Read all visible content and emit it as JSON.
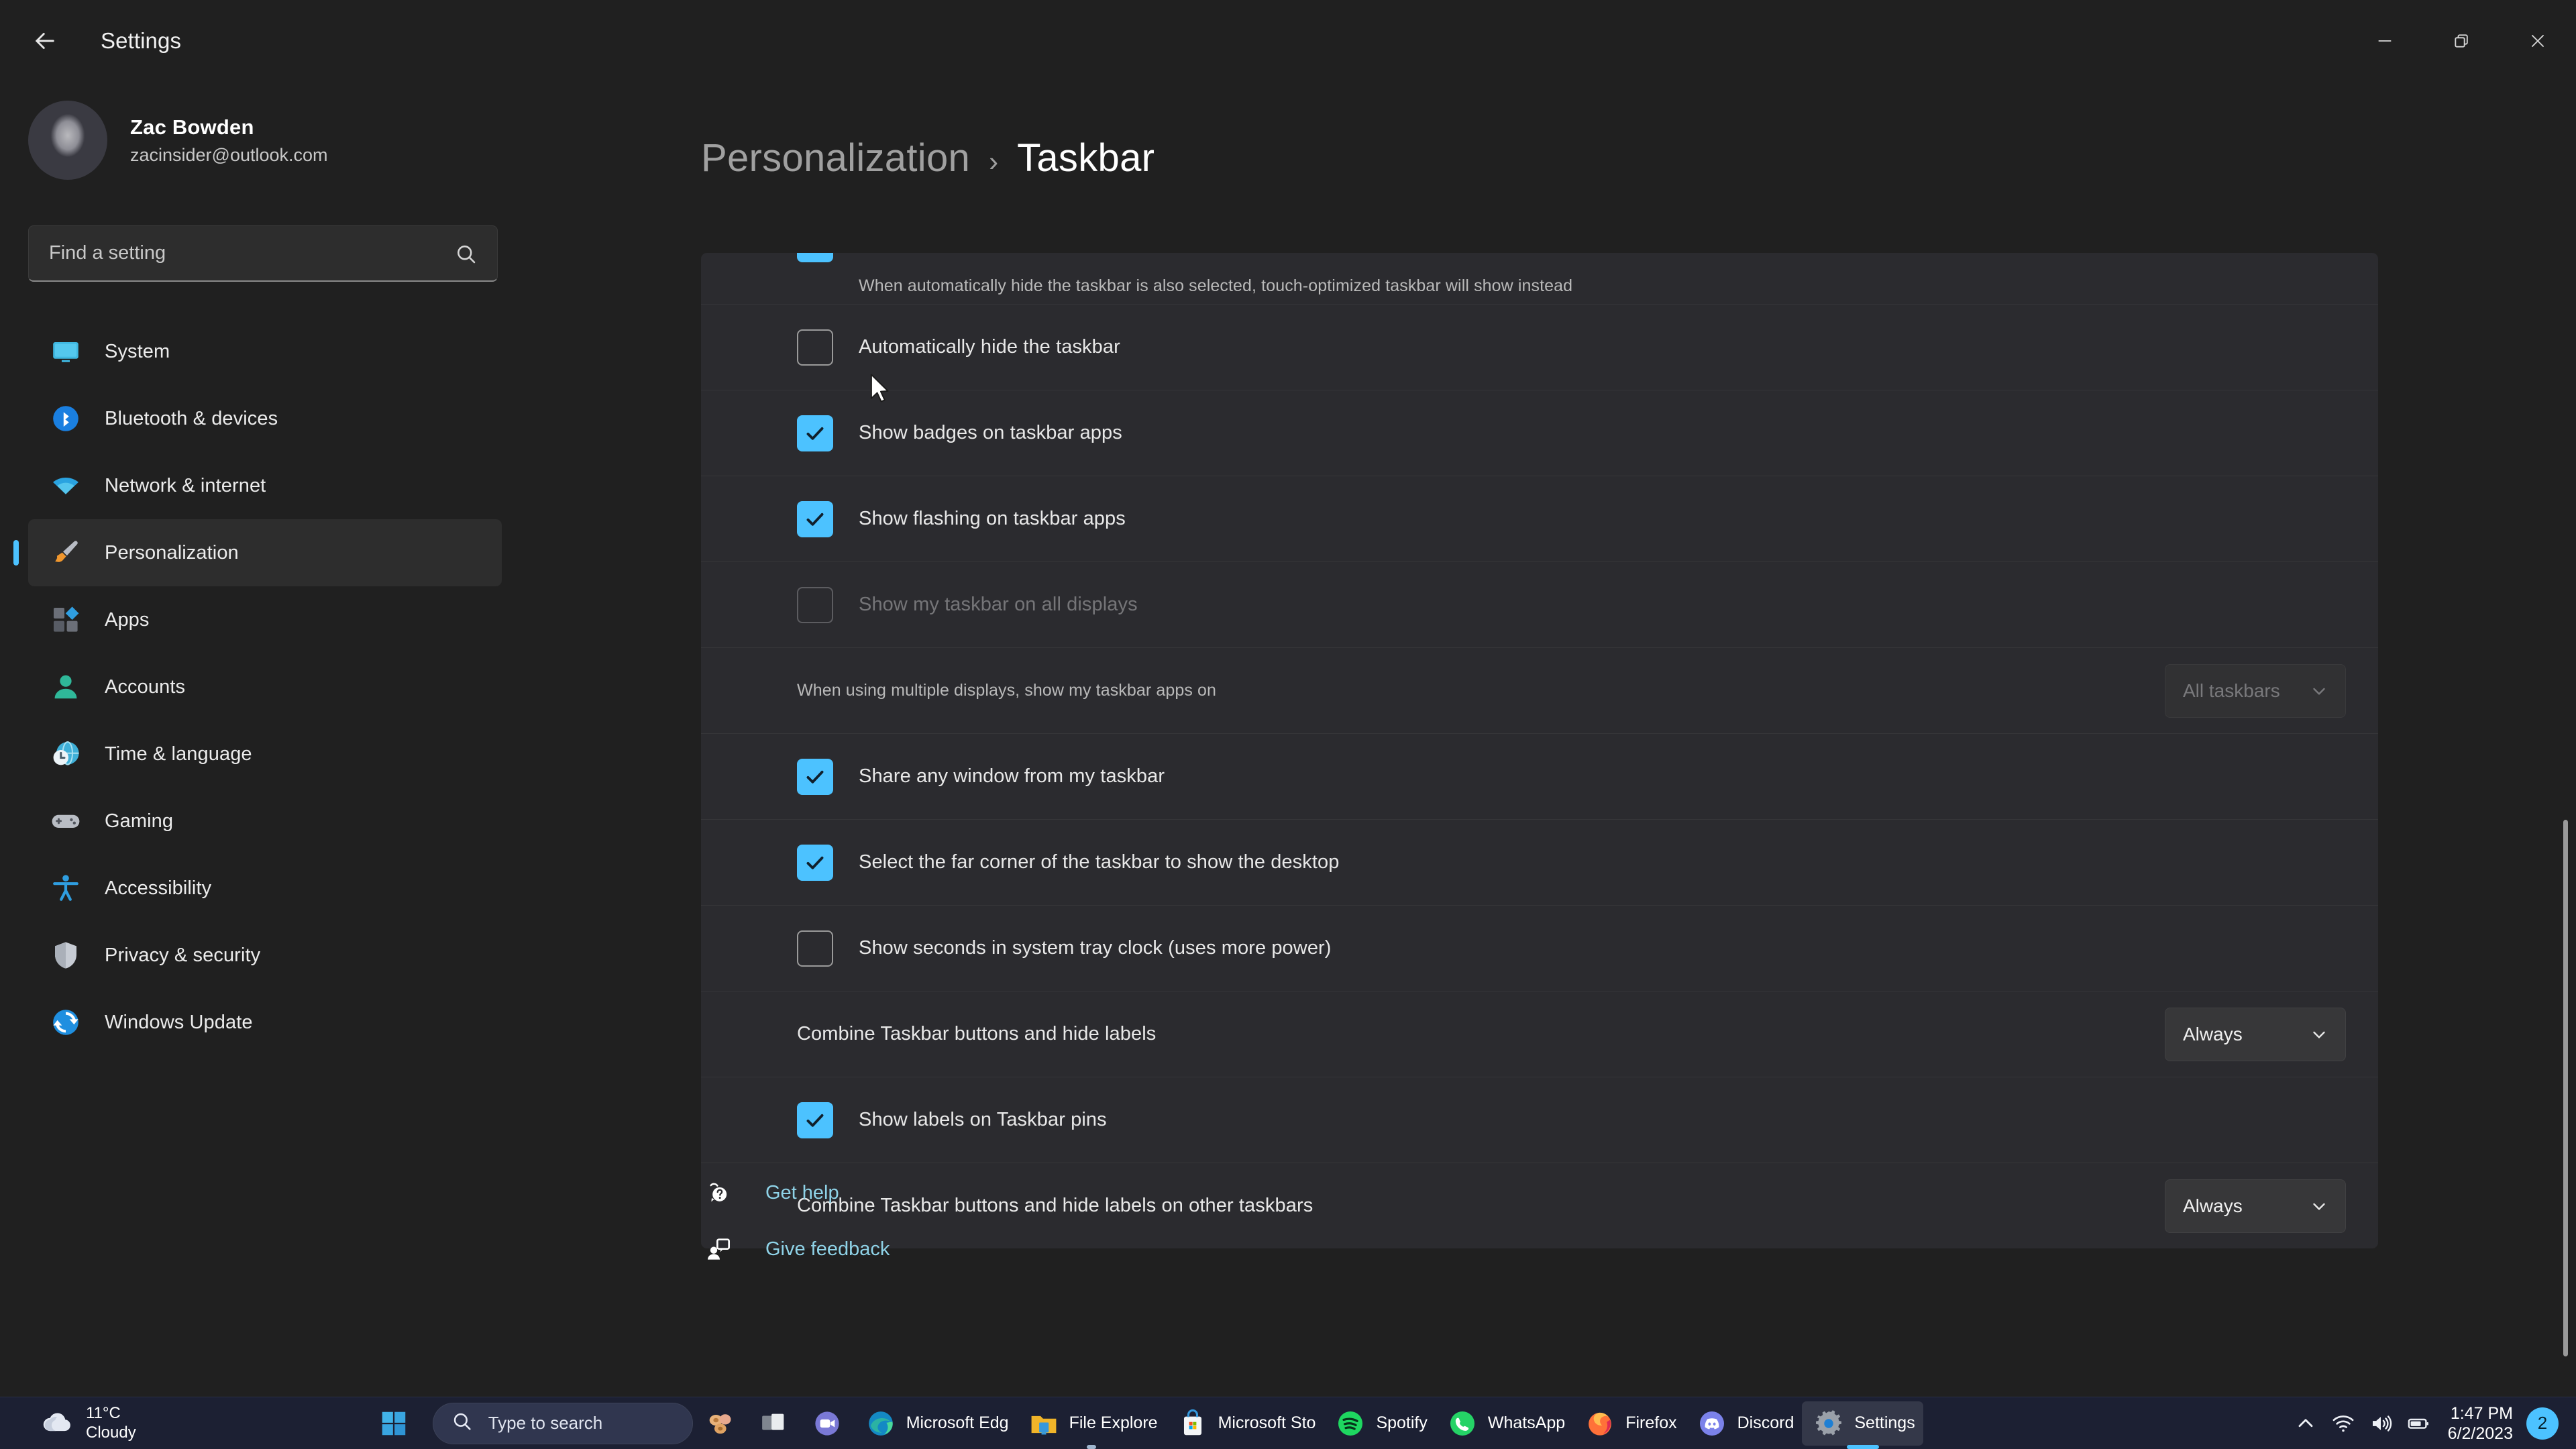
{
  "window": {
    "title": "Settings",
    "back_icon": "arrow-left-icon",
    "controls": {
      "minimize": "minimize-icon",
      "restore": "restore-icon",
      "close": "close-icon"
    }
  },
  "sidebar": {
    "profile": {
      "name": "Zac Bowden",
      "email": "zacinsider@outlook.com"
    },
    "search": {
      "placeholder": "Find a setting",
      "value": "",
      "icon": "search-icon"
    },
    "items": [
      {
        "label": "System",
        "icon": "monitor-icon",
        "selected": false
      },
      {
        "label": "Bluetooth & devices",
        "icon": "bluetooth-icon",
        "selected": false
      },
      {
        "label": "Network & internet",
        "icon": "wifi-icon",
        "selected": false
      },
      {
        "label": "Personalization",
        "icon": "paintbrush-icon",
        "selected": true
      },
      {
        "label": "Apps",
        "icon": "apps-grid-icon",
        "selected": false
      },
      {
        "label": "Accounts",
        "icon": "person-icon",
        "selected": false
      },
      {
        "label": "Time & language",
        "icon": "clock-globe-icon",
        "selected": false
      },
      {
        "label": "Gaming",
        "icon": "gamepad-icon",
        "selected": false
      },
      {
        "label": "Accessibility",
        "icon": "accessibility-icon",
        "selected": false
      },
      {
        "label": "Privacy & security",
        "icon": "shield-icon",
        "selected": false
      },
      {
        "label": "Windows Update",
        "icon": "update-icon",
        "selected": false
      }
    ]
  },
  "breadcrumb": {
    "parent": "Personalization",
    "separator": "›",
    "current": "Taskbar"
  },
  "settings_rows": [
    {
      "type": "clipped-description",
      "description": "When automatically hide the taskbar is also selected, touch-optimized taskbar will show instead",
      "checkbox": {
        "checked": true,
        "clipped": true
      },
      "disabled": false
    },
    {
      "type": "checkbox",
      "label": "Automatically hide the taskbar",
      "checkbox": {
        "checked": false
      },
      "disabled": false
    },
    {
      "type": "checkbox",
      "label": "Show badges on taskbar apps",
      "checkbox": {
        "checked": true
      },
      "disabled": false
    },
    {
      "type": "checkbox",
      "label": "Show flashing on taskbar apps",
      "checkbox": {
        "checked": true
      },
      "disabled": false
    },
    {
      "type": "checkbox",
      "label": "Show my taskbar on all displays",
      "checkbox": {
        "checked": false
      },
      "disabled": true
    },
    {
      "type": "dropdown",
      "label": "When using multiple displays, show my taskbar apps on",
      "dropdown": {
        "value": "All taskbars",
        "icon": "chevron-down-icon"
      },
      "disabled": true
    },
    {
      "type": "checkbox",
      "label": "Share any window from my taskbar",
      "checkbox": {
        "checked": true
      },
      "disabled": false
    },
    {
      "type": "checkbox",
      "label": "Select the far corner of the taskbar to show the desktop",
      "checkbox": {
        "checked": true
      },
      "disabled": false
    },
    {
      "type": "checkbox",
      "label": "Show seconds in system tray clock (uses more power)",
      "checkbox": {
        "checked": false
      },
      "disabled": false
    },
    {
      "type": "dropdown",
      "label": "Combine Taskbar buttons and hide labels",
      "dropdown": {
        "value": "Always",
        "icon": "chevron-down-icon"
      },
      "disabled": false
    },
    {
      "type": "checkbox",
      "label": "Show labels on Taskbar pins",
      "checkbox": {
        "checked": true
      },
      "disabled": false
    },
    {
      "type": "dropdown",
      "label": "Combine Taskbar buttons and hide labels on other taskbars",
      "dropdown": {
        "value": "Always",
        "icon": "chevron-down-icon"
      },
      "disabled": false
    }
  ],
  "footer_links": [
    {
      "label": "Get help",
      "icon": "help-question-icon"
    },
    {
      "label": "Give feedback",
      "icon": "feedback-icon"
    }
  ],
  "taskbar": {
    "weather": {
      "temperature": "11°C",
      "condition": "Cloudy",
      "icon": "cloud-icon"
    },
    "start": {
      "icon": "windows-start-icon"
    },
    "search": {
      "placeholder": "Type to search",
      "icon": "search-icon"
    },
    "unlabeled_buttons": [
      {
        "icon": "copilot-icon"
      },
      {
        "icon": "task-view-icon"
      },
      {
        "icon": "teams-chat-icon"
      }
    ],
    "apps": [
      {
        "label": "Microsoft Edg",
        "icon": "edge-icon",
        "running": false,
        "active": false
      },
      {
        "label": "File Explore",
        "icon": "folder-icon",
        "running": true,
        "active": false
      },
      {
        "label": "Microsoft Sto",
        "icon": "store-icon",
        "running": false,
        "active": false
      },
      {
        "label": "Spotify",
        "icon": "spotify-icon",
        "running": false,
        "active": false
      },
      {
        "label": "WhatsApp",
        "icon": "whatsapp-icon",
        "running": false,
        "active": false
      },
      {
        "label": "Firefox",
        "icon": "firefox-icon",
        "running": false,
        "active": false
      },
      {
        "label": "Discord",
        "icon": "discord-icon",
        "running": false,
        "active": false
      },
      {
        "label": "Settings",
        "icon": "settings-gear-icon",
        "running": true,
        "active": true
      }
    ],
    "tray": {
      "overflow_icon": "chevron-up-icon",
      "wifi_icon": "wifi-icon",
      "volume_icon": "speaker-icon",
      "battery_icon": "battery-icon",
      "time": "1:47 PM",
      "date": "6/2/2023",
      "notification_count": "2"
    }
  },
  "colors": {
    "accent": "#4cc2ff",
    "window_bg": "#202020",
    "card_bg": "#2b2b2f",
    "taskbar_bg": "#1c2033",
    "link": "#8fd3e8"
  }
}
